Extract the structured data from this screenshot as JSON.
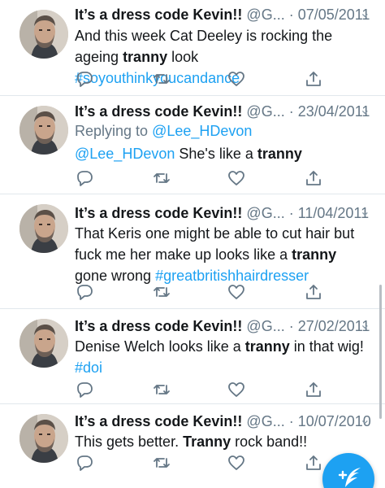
{
  "tweets": [
    {
      "name": "It’s a dress code Kevin!!",
      "handle": "@G... · 07/05/2011",
      "replying": null,
      "body": [
        {
          "t": "And this week Cat Deeley is rocking the ageing ",
          "s": ""
        },
        {
          "t": "tranny",
          "s": "b"
        },
        {
          "t": " look ",
          "s": ""
        },
        {
          "t": "#soyouthinkyoucandance",
          "s": "link"
        }
      ]
    },
    {
      "name": "It’s a dress code Kevin!!",
      "handle": "@G... · 23/04/2011",
      "replying": {
        "prefix": "Replying to ",
        "user": "@Lee_HDevon"
      },
      "body": [
        {
          "t": "@Lee_HDevon",
          "s": "link"
        },
        {
          "t": " She's like a ",
          "s": ""
        },
        {
          "t": "tranny",
          "s": "b"
        }
      ]
    },
    {
      "name": "It’s a dress code Kevin!!",
      "handle": "@G... · 11/04/2011",
      "replying": null,
      "body": [
        {
          "t": "That Keris one might be able to cut hair but fuck me her make up looks like a ",
          "s": ""
        },
        {
          "t": "tranny",
          "s": "b"
        },
        {
          "t": " gone wrong ",
          "s": ""
        },
        {
          "t": "#greatbritishhairdresser",
          "s": "link"
        }
      ]
    },
    {
      "name": "It’s a dress code Kevin!!",
      "handle": "@G... · 27/02/2011",
      "replying": null,
      "body": [
        {
          "t": "Denise Welch looks like a ",
          "s": ""
        },
        {
          "t": "tranny",
          "s": "b"
        },
        {
          "t": " in that wig! ",
          "s": ""
        },
        {
          "t": "#doi",
          "s": "link"
        }
      ]
    },
    {
      "name": "It’s a dress code Kevin!!",
      "handle": "@G... · 10/07/2010",
      "replying": null,
      "body": [
        {
          "t": "This gets better. ",
          "s": ""
        },
        {
          "t": "Tranny",
          "s": "b"
        },
        {
          "t": " rock band!!",
          "s": ""
        }
      ]
    }
  ],
  "icons": {
    "reply": "reply-icon",
    "retweet": "retweet-icon",
    "like": "heart-icon",
    "share": "share-icon",
    "more": "chevron-down-icon",
    "compose": "compose-tweet-icon"
  },
  "colors": {
    "link": "#1da1f2",
    "text": "#14171a",
    "secondary": "#657786",
    "divider": "#e1e8ed",
    "fab": "#1da1f2"
  }
}
